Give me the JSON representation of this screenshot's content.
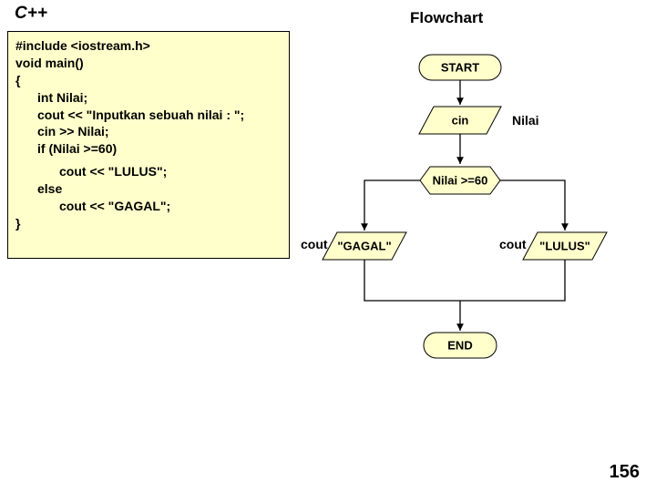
{
  "headings": {
    "cpp": "C++",
    "flowchart": "Flowchart"
  },
  "code": {
    "l1": "#include <iostream.h>",
    "l2": "void main()",
    "l3": "{",
    "l4": "int Nilai;",
    "l5": "cout << \"Inputkan sebuah nilai : \";",
    "l6": "cin >> Nilai;",
    "l7": "if (Nilai >=60)",
    "l8": "cout << \"LULUS\";",
    "l9": "else",
    "l10": "cout << \"GAGAL\";",
    "l11": "}"
  },
  "flow": {
    "start": "START",
    "cin": "cin",
    "nilai_label": "Nilai",
    "cond": "Nilai >=60",
    "gagal": "\"GAGAL\"",
    "lulus": "\"LULUS\"",
    "cout_left": "cout",
    "cout_right": "cout",
    "end": "END"
  },
  "page_number": "156"
}
